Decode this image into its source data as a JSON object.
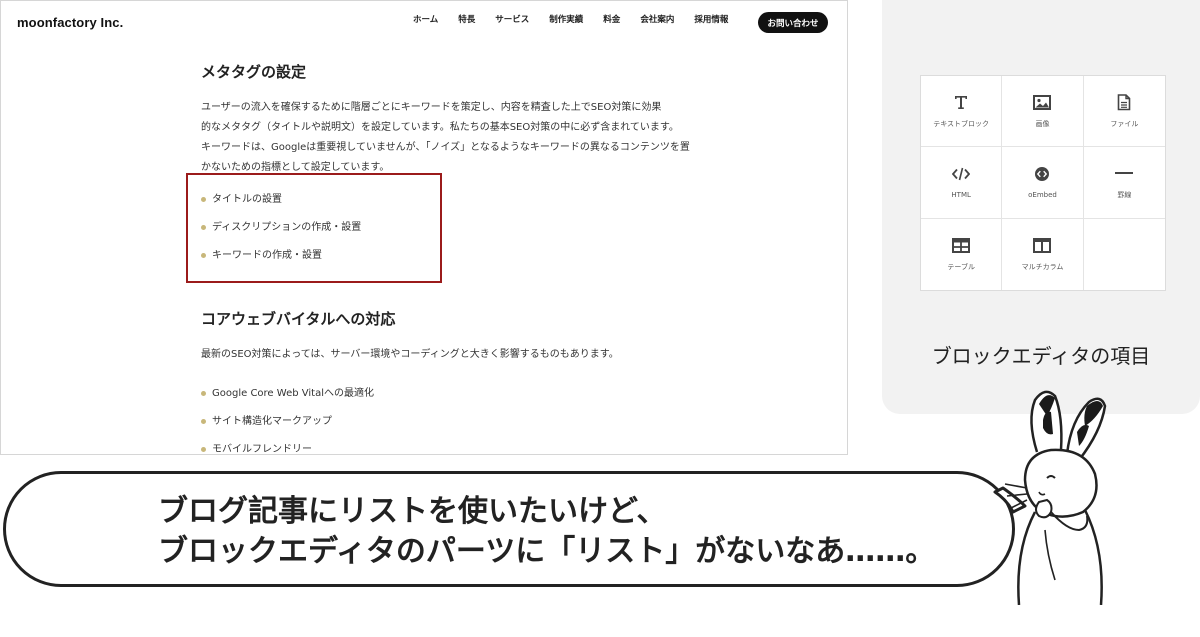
{
  "site": {
    "logo": "moonfactory Inc.",
    "nav": [
      "ホーム",
      "特長",
      "サービス",
      "制作実績",
      "料金",
      "会社案内",
      "採用情報"
    ],
    "contact_button": "お問い合わせ",
    "sections": [
      {
        "heading": "メタタグの設定",
        "paragraph_lines": [
          "ユーザーの流入を確保するために階層ごとにキーワードを策定し、内容を精査した上でSEO対策に効果",
          "的なメタタグ（タイトルや説明文）を設定しています。私たちの基本SEO対策の中に必ず含まれています。",
          "キーワードは、Googleは重要視していませんが、「ノイズ」となるようなキーワードの異なるコンテンツを置",
          "かないための指標として設定しています。"
        ],
        "bullets": [
          "タイトルの設置",
          "ディスクリプションの作成・設置",
          "キーワードの作成・設置"
        ]
      },
      {
        "heading": "コアウェブバイタルへの対応",
        "paragraph_lines": [
          "最新のSEO対策によっては、サーバー環境やコーディングと大きく影響するものもあります。"
        ],
        "bullets": [
          "Google Core Web Vitalへの最適化",
          "サイト構造化マークアップ",
          "モバイルフレンドリー"
        ]
      }
    ],
    "bullet_color": "#c8b77a",
    "highlight_color": "#9b1b1b"
  },
  "block_panel": {
    "blocks": [
      {
        "label": "テキストブロック",
        "icon": "text-icon"
      },
      {
        "label": "画像",
        "icon": "image-icon"
      },
      {
        "label": "ファイル",
        "icon": "file-icon"
      },
      {
        "label": "HTML",
        "icon": "code-icon"
      },
      {
        "label": "oEmbed",
        "icon": "embed-icon"
      },
      {
        "label": "罫線",
        "icon": "separator-icon"
      },
      {
        "label": "テーブル",
        "icon": "table-icon"
      },
      {
        "label": "マルチカラム",
        "icon": "columns-icon"
      }
    ],
    "caption": "ブロックエディタの項目"
  },
  "bubble": {
    "line1": "ブログ記事にリストを使いたいけど、",
    "line2": "ブロックエディタのパーツに「リスト」がないなあ……。"
  }
}
